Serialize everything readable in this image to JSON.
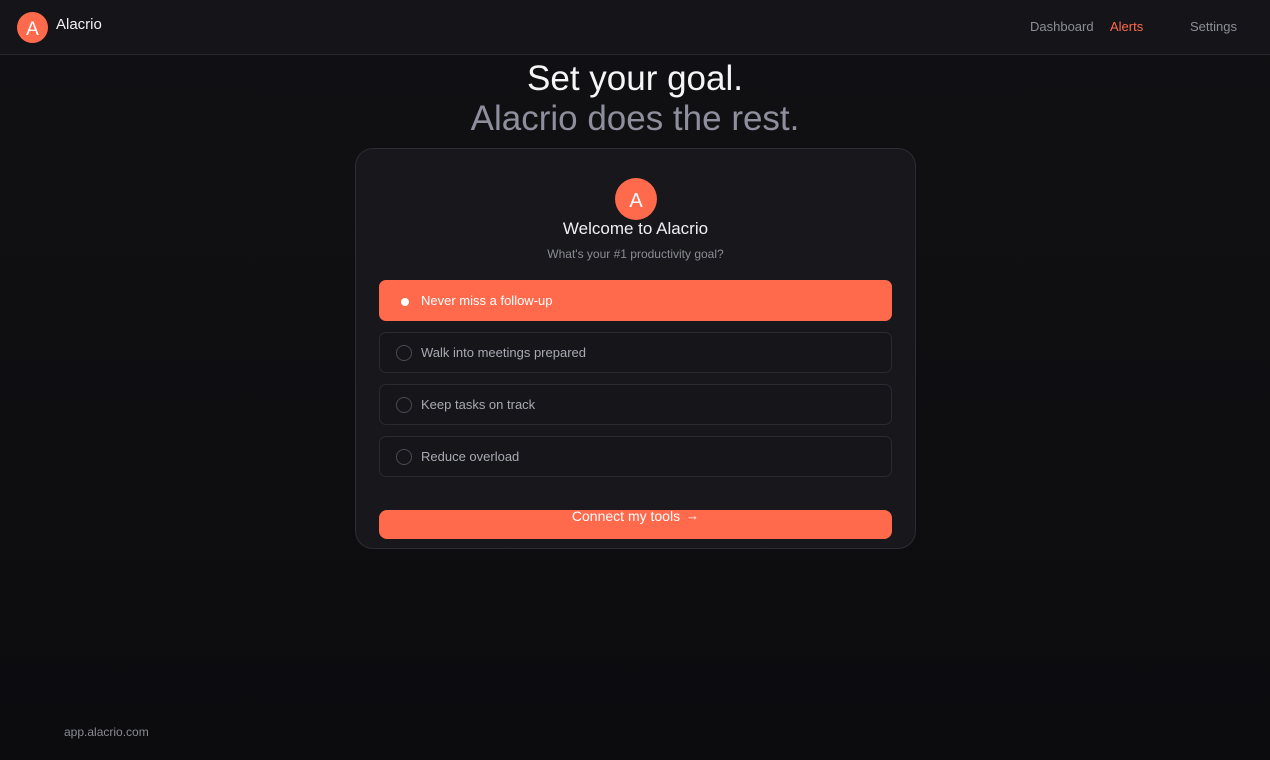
{
  "brand": {
    "mark": "A",
    "name": "Alacrio"
  },
  "nav": [
    {
      "label": "Dashboard",
      "active": false
    },
    {
      "label": "Alerts",
      "active": true
    },
    {
      "label": "Settings",
      "active": false
    }
  ],
  "hero": {
    "line1": "Set your goal.",
    "line2": "Alacrio does the rest."
  },
  "card": {
    "logo": "A",
    "title": "Welcome to Alacrio",
    "subtitle": "What's your #1 productivity goal?",
    "options": [
      {
        "label": "Never miss a follow-up",
        "selected": true
      },
      {
        "label": "Walk into meetings prepared",
        "selected": false
      },
      {
        "label": "Keep tasks on track",
        "selected": false
      },
      {
        "label": "Reduce overload",
        "selected": false
      }
    ],
    "cta_label": "Connect my tools",
    "cta_arrow": "→"
  },
  "footer": {
    "url": "app.alacrio.com"
  },
  "colors": {
    "accent": "#ff6a4d",
    "background": "#0f0f12",
    "card": "#17171c"
  }
}
